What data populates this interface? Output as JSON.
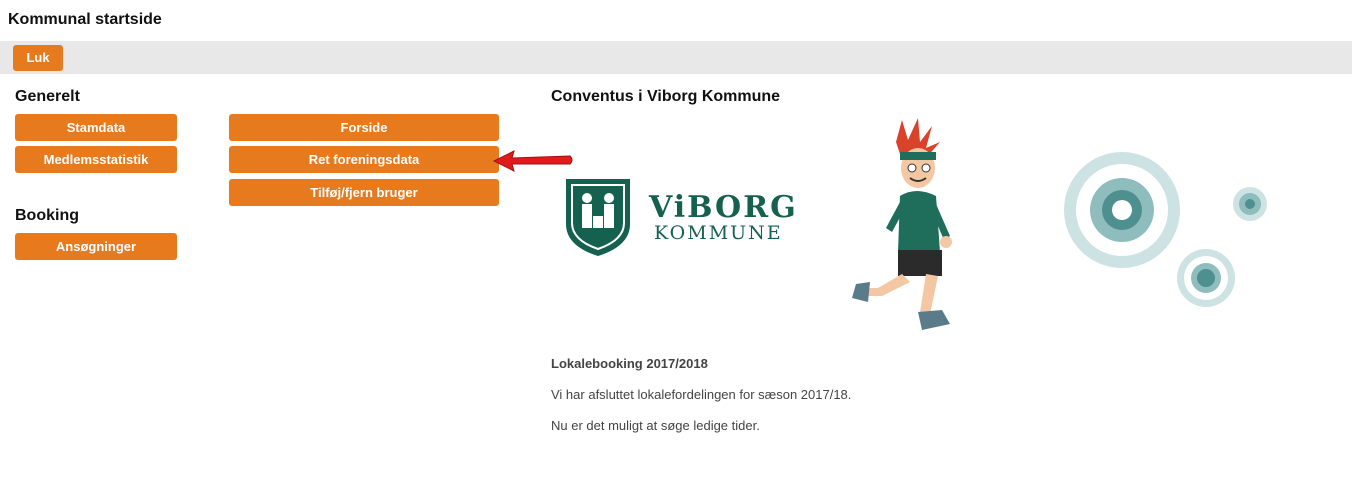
{
  "page": {
    "title": "Kommunal startside"
  },
  "toolbar": {
    "close_label": "Luk"
  },
  "general": {
    "heading": "Generelt",
    "buttons": [
      "Stamdata",
      "Medlemsstatistik"
    ],
    "buttons_right": [
      "Forside",
      "Ret foreningsdata",
      "Tilføj/fjern bruger"
    ]
  },
  "booking": {
    "heading": "Booking",
    "buttons": [
      "Ansøgninger"
    ]
  },
  "content": {
    "title": "Conventus i Viborg Kommune",
    "logo_line1": "ViBORG",
    "logo_line2": "KOMMUNE",
    "news_title": "Lokalebooking 2017/2018",
    "news_p1": "Vi har afsluttet lokalefordelingen for sæson 2017/18.",
    "news_p2": "Nu er det muligt at søge ledige tider."
  },
  "colors": {
    "accent": "#e87a1e",
    "brand_green": "#14614f",
    "arrow": "#e01b1b",
    "teal": "#4e8f8f"
  },
  "icons": {
    "annotation": "red-arrow-icon",
    "logo": "viborg-crest-icon"
  }
}
